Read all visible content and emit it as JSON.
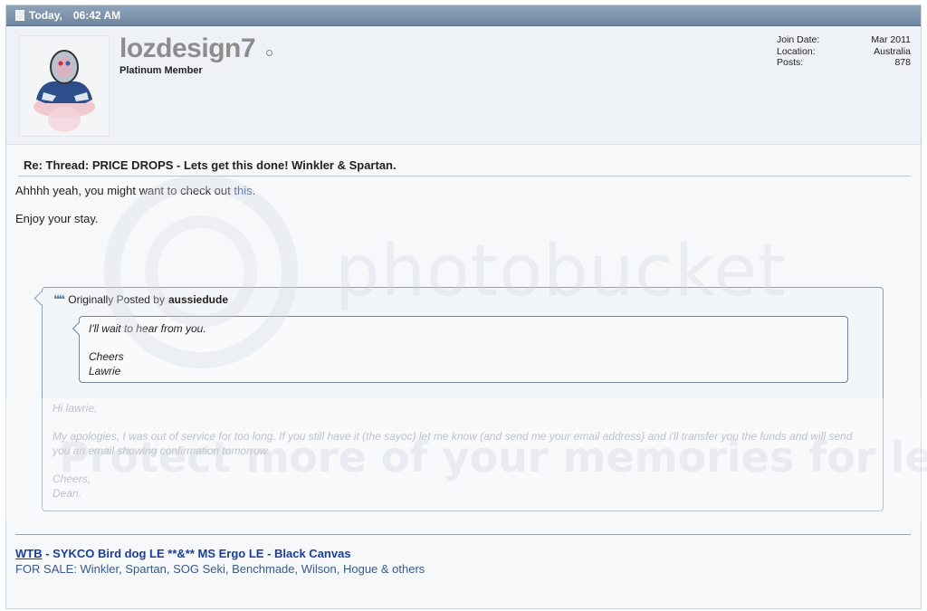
{
  "header": {
    "day": "Today,",
    "time": "06:42 AM"
  },
  "user": {
    "name": "lozdesign7",
    "title": "Platinum Member",
    "stats": [
      {
        "label": "Join Date:",
        "value": "Mar 2011"
      },
      {
        "label": "Location:",
        "value": "Australia"
      },
      {
        "label": "Posts:",
        "value": "878"
      }
    ]
  },
  "post": {
    "title": "Re: Thread: PRICE DROPS - Lets get this done! Winkler & Spartan.",
    "line1_prefix": "Ahhhh yeah, you might want to check out ",
    "line1_link": "this",
    "line1_suffix": ".",
    "line2": "Enjoy your stay."
  },
  "quote": {
    "posted_by_label": "Originally Posted by",
    "posted_by_user": "aussiedude",
    "inner_lines": [
      "I'll wait to hear from you.",
      "Cheers",
      "Lawrie"
    ],
    "greeting": "Hi lawrie,",
    "body": "My apologies, I was out of service for too long. If you still have it (the sayoc) let me know (and send me your email address) and i'll transfer you the funds and will send you an email showing confirmation tomorrow.",
    "signoff1": "Cheers,",
    "signoff2": "Dean."
  },
  "signature": {
    "wtb": "WTB",
    "line1_rest": " - SYKCO Bird dog LE **&** MS Ergo LE - Black Canvas",
    "line2": "FOR SALE: Winkler, Spartan, SOG Seki, Benchmade, Wilson, Hogue & others"
  },
  "watermark": {
    "text1": "photobucket",
    "text2": "Protect more of your memories for less!"
  }
}
